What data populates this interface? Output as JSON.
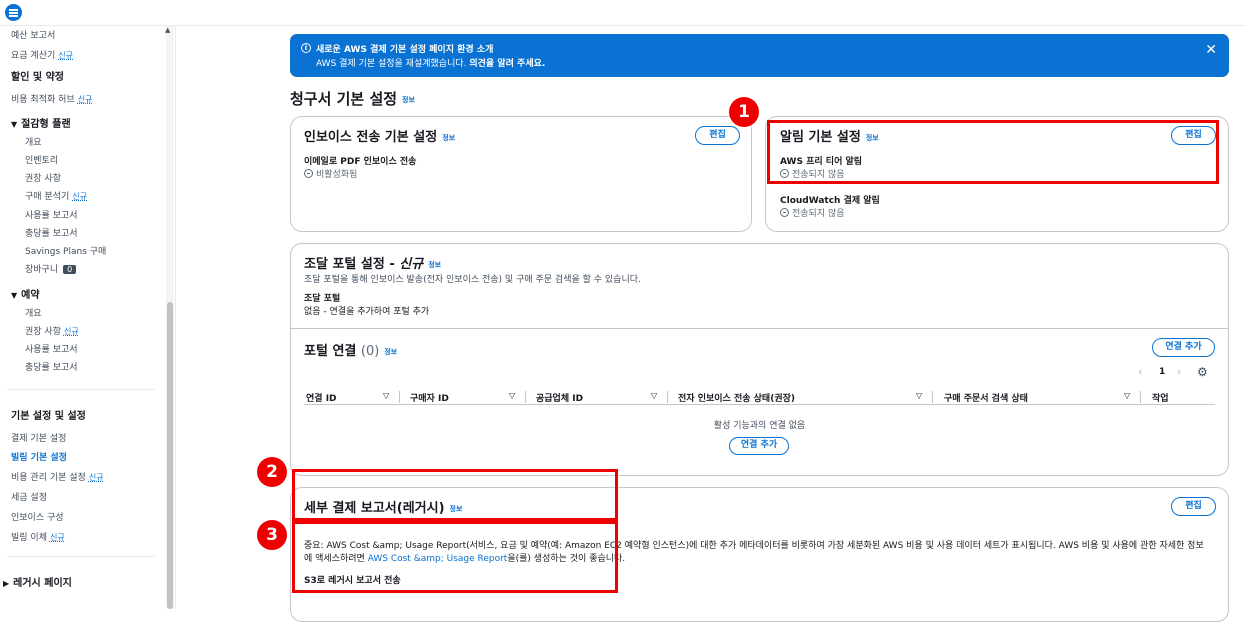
{
  "sidebar": {
    "items": [
      {
        "label": "예산 보고서"
      },
      {
        "label": "요금 계산기",
        "tag": "신규"
      },
      {
        "label": "할인 및 약정"
      },
      {
        "label": "비용 최적화 허브",
        "tag": "신규"
      },
      {
        "label": "절감형 플랜"
      },
      {
        "label": "개요"
      },
      {
        "label": "인벤토리"
      },
      {
        "label": "권장 사항"
      },
      {
        "label": "구매 분석기",
        "tag": "신규"
      },
      {
        "label": "사용률 보고서"
      },
      {
        "label": "충당률 보고서"
      },
      {
        "label": "Savings Plans 구매"
      },
      {
        "label": "장바구니",
        "badge": "0"
      },
      {
        "label": "예약"
      },
      {
        "label": "개요"
      },
      {
        "label": "권장 사항",
        "tag": "신규"
      },
      {
        "label": "사용률 보고서"
      },
      {
        "label": "충당률 보고서"
      },
      {
        "label": "기본 설정 및 설정"
      },
      {
        "label": "결제 기본 설정"
      },
      {
        "label": "빌링 기본 설정"
      },
      {
        "label": "비용 관리 기본 설정",
        "tag": "신규"
      },
      {
        "label": "세금 설정"
      },
      {
        "label": "인보이스 구성"
      },
      {
        "label": "빌링 이체",
        "tag": "신규"
      },
      {
        "label": "레거시 페이지"
      }
    ]
  },
  "flash": {
    "title": "새로운 AWS 결제 기본 설정 페이지 환경 소개",
    "body": "AWS 결제 기본 설정을 재설계했습니다. ",
    "body_bold": "의견을 알려 주세요."
  },
  "page": {
    "title": "청구서 기본 설정",
    "info": "정보"
  },
  "invoice_card": {
    "title": "인보이스 전송 기본 설정",
    "info": "정보",
    "edit": "편집",
    "field_label": "이메일로 PDF 인보이스 전송",
    "field_value": "비활성화됨"
  },
  "alert_card": {
    "title": "알림 기본 설정",
    "info": "정보",
    "edit": "편집",
    "f1_label": "AWS 프리 티어 알림",
    "f1_value": "전송되지 않음",
    "f2_label": "CloudWatch 결제 알림",
    "f2_value": "전송되지 않음"
  },
  "procure_card": {
    "title": "조달 포털 설정 - ",
    "title_new": "신규",
    "info": "정보",
    "desc": "조달 포털을 통해 인보이스 발송(전자 인보이스 전송) 및 구매 주문 검색을 할 수 있습니다.",
    "field_label": "조달 포털",
    "field_value": "없음 - 연결을 추가하여 포털 추가",
    "connections_title": "포털 연결",
    "connections_count": "(0)",
    "add_connection": "연결 추가",
    "page_number": "1",
    "columns": [
      "연결 ID",
      "구매자 ID",
      "공급업체 ID",
      "전자 인보이스 전송 상태(권장)",
      "구매 주문서 검색 상태",
      "작업"
    ],
    "empty_text": "활성 기능과의 연결 없음",
    "add_connection_2": "연결 추가"
  },
  "legacy_card": {
    "title": "세부 결제 보고서(레거시)",
    "info": "정보",
    "edit": "편집",
    "desc_1": "중요: AWS Cost &amp; Usage Report(서비스, 요금 및 예약(예: Amazon EC2 예약형 인스턴스)에 대한 추가 메타데이터를 비롯하여 가장 세분화된 AWS 비용 및 사용 데이터 세트가 표시됩니다. AWS 비용 및 사용에 관한 자세한 정보",
    "desc_2_pre": "에 액세스하려면 ",
    "desc_2_link": "AWS Cost &amp; Usage Report",
    "desc_2_post": "을(를) 생성하는 것이 좋습니다.",
    "field_label": "S3로 레거시 보고서 전송"
  },
  "annotations": [
    "1",
    "2",
    "3"
  ],
  "colors": {
    "accent": "#0972d3",
    "highlight": "#ee0000",
    "text": "#16191f"
  }
}
